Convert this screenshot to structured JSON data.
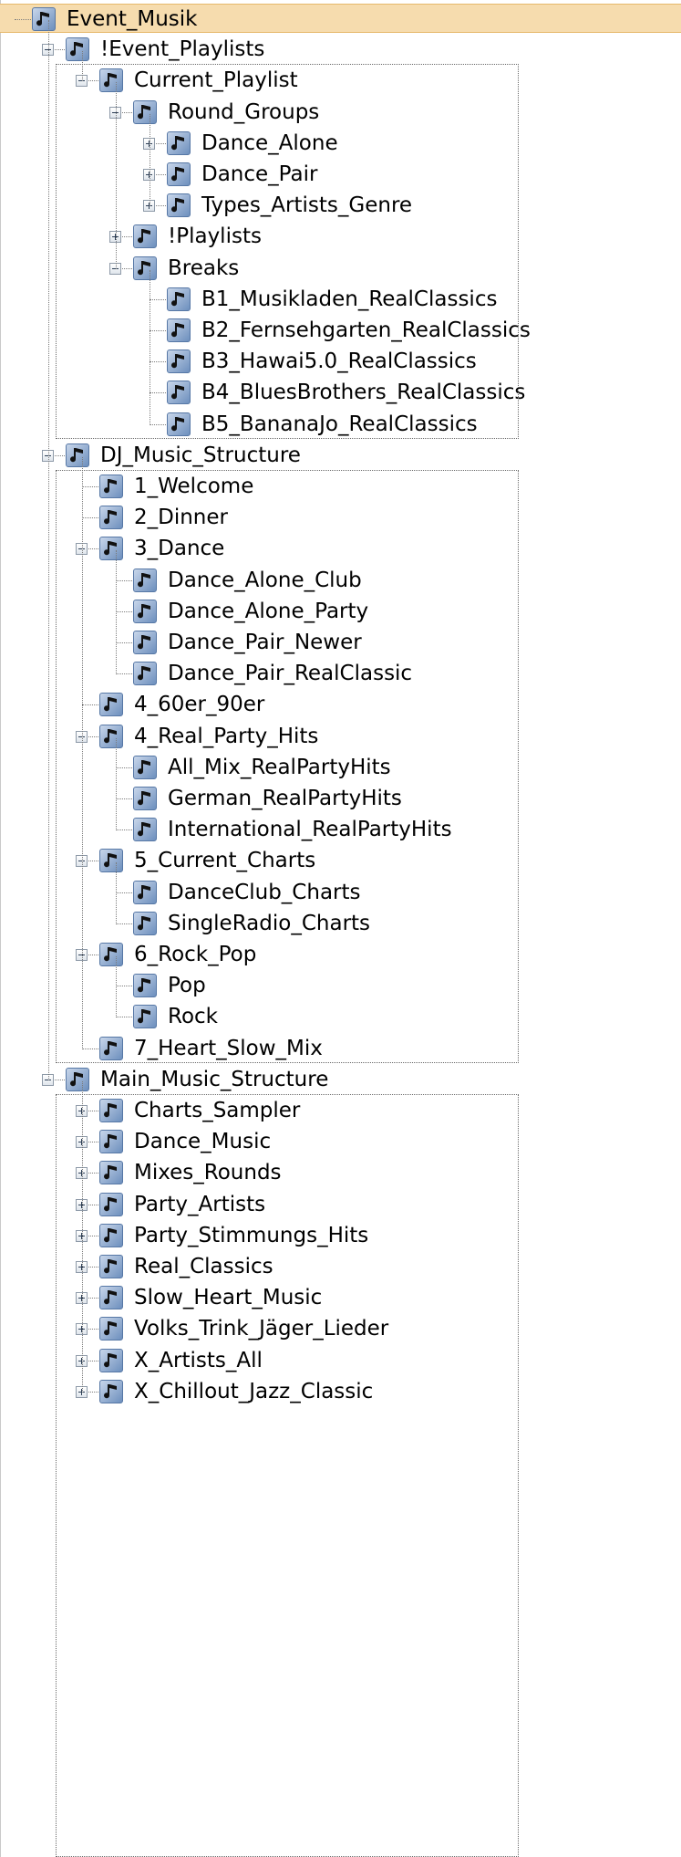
{
  "tree": {
    "root": {
      "label": "Event_Musik",
      "selected": true
    },
    "nodes": [
      {
        "id": "event_playlists",
        "label": "!Event_Playlists",
        "level": 1,
        "expander": "minus"
      },
      {
        "id": "current_playlist",
        "label": "Current_Playlist",
        "level": 2,
        "expander": "minus"
      },
      {
        "id": "round_groups",
        "label": "Round_Groups",
        "level": 3,
        "expander": "minus"
      },
      {
        "id": "dance_alone",
        "label": "Dance_Alone",
        "level": 4,
        "expander": "plus"
      },
      {
        "id": "dance_pair",
        "label": "Dance_Pair",
        "level": 4,
        "expander": "plus"
      },
      {
        "id": "types_artists_genre",
        "label": "Types_Artists_Genre",
        "level": 4,
        "expander": "plus"
      },
      {
        "id": "playlists",
        "label": "!Playlists",
        "level": 3,
        "expander": "plus"
      },
      {
        "id": "breaks",
        "label": "Breaks",
        "level": 3,
        "expander": "minus"
      },
      {
        "id": "b1",
        "label": "B1_Musikladen_RealClassics",
        "level": 4,
        "expander": "none"
      },
      {
        "id": "b2",
        "label": "B2_Fernsehgarten_RealClassics",
        "level": 4,
        "expander": "none"
      },
      {
        "id": "b3",
        "label": "B3_Hawai5.0_RealClassics",
        "level": 4,
        "expander": "none"
      },
      {
        "id": "b4",
        "label": "B4_BluesBrothers_RealClassics",
        "level": 4,
        "expander": "none"
      },
      {
        "id": "b5",
        "label": "B5_BananaJo_RealClassics",
        "level": 4,
        "expander": "none"
      },
      {
        "id": "dj_music_structure",
        "label": "DJ_Music_Structure",
        "level": 1,
        "expander": "minus"
      },
      {
        "id": "welcome",
        "label": "1_Welcome",
        "level": 2,
        "expander": "none"
      },
      {
        "id": "dinner",
        "label": "2_Dinner",
        "level": 2,
        "expander": "none"
      },
      {
        "id": "dance",
        "label": "3_Dance",
        "level": 2,
        "expander": "minus"
      },
      {
        "id": "dance_alone_club",
        "label": "Dance_Alone_Club",
        "level": 3,
        "expander": "none"
      },
      {
        "id": "dance_alone_party",
        "label": "Dance_Alone_Party",
        "level": 3,
        "expander": "none"
      },
      {
        "id": "dance_pair_newer",
        "label": "Dance_Pair_Newer",
        "level": 3,
        "expander": "none"
      },
      {
        "id": "dance_pair_realclassic",
        "label": "Dance_Pair_RealClassic",
        "level": 3,
        "expander": "none"
      },
      {
        "id": "60er_90er",
        "label": "4_60er_90er",
        "level": 2,
        "expander": "none"
      },
      {
        "id": "real_party_hits",
        "label": "4_Real_Party_Hits",
        "level": 2,
        "expander": "minus"
      },
      {
        "id": "all_mix",
        "label": "All_Mix_RealPartyHits",
        "level": 3,
        "expander": "none"
      },
      {
        "id": "german_rph",
        "label": "German_RealPartyHits",
        "level": 3,
        "expander": "none"
      },
      {
        "id": "international_rph",
        "label": "International_RealPartyHits",
        "level": 3,
        "expander": "none"
      },
      {
        "id": "current_charts",
        "label": "5_Current_Charts",
        "level": 2,
        "expander": "minus"
      },
      {
        "id": "danceclub_charts",
        "label": "DanceClub_Charts",
        "level": 3,
        "expander": "none"
      },
      {
        "id": "singleradio_charts",
        "label": "SingleRadio_Charts",
        "level": 3,
        "expander": "none"
      },
      {
        "id": "rock_pop",
        "label": "6_Rock_Pop",
        "level": 2,
        "expander": "minus"
      },
      {
        "id": "pop",
        "label": "Pop",
        "level": 3,
        "expander": "none"
      },
      {
        "id": "rock",
        "label": "Rock",
        "level": 3,
        "expander": "none"
      },
      {
        "id": "heart_slow_mix",
        "label": "7_Heart_Slow_Mix",
        "level": 2,
        "expander": "none"
      },
      {
        "id": "main_music_structure",
        "label": "Main_Music_Structure",
        "level": 1,
        "expander": "minus"
      },
      {
        "id": "charts_sampler",
        "label": "Charts_Sampler",
        "level": 2,
        "expander": "plus"
      },
      {
        "id": "dance_music",
        "label": "Dance_Music",
        "level": 2,
        "expander": "plus"
      },
      {
        "id": "mixes_rounds",
        "label": "Mixes_Rounds",
        "level": 2,
        "expander": "plus"
      },
      {
        "id": "party_artists",
        "label": "Party_Artists",
        "level": 2,
        "expander": "plus"
      },
      {
        "id": "party_stimmungs_hits",
        "label": "Party_Stimmungs_Hits",
        "level": 2,
        "expander": "plus"
      },
      {
        "id": "real_classics",
        "label": "Real_Classics",
        "level": 2,
        "expander": "plus"
      },
      {
        "id": "slow_heart_music",
        "label": "Slow_Heart_Music",
        "level": 2,
        "expander": "plus"
      },
      {
        "id": "volks_trink",
        "label": "Volks_Trink_Jäger_Lieder",
        "level": 2,
        "expander": "plus"
      },
      {
        "id": "x_artists_all",
        "label": "X_Artists_All",
        "level": 2,
        "expander": "plus"
      },
      {
        "id": "x_chillout",
        "label": "X_Chillout_Jazz_Classic",
        "level": 2,
        "expander": "plus"
      }
    ],
    "icon": "music-note-icon",
    "colors": {
      "selection_bg": "#f6dcae",
      "selection_border": "#e6b96c",
      "icon_fill": "#6d8fbd"
    }
  }
}
